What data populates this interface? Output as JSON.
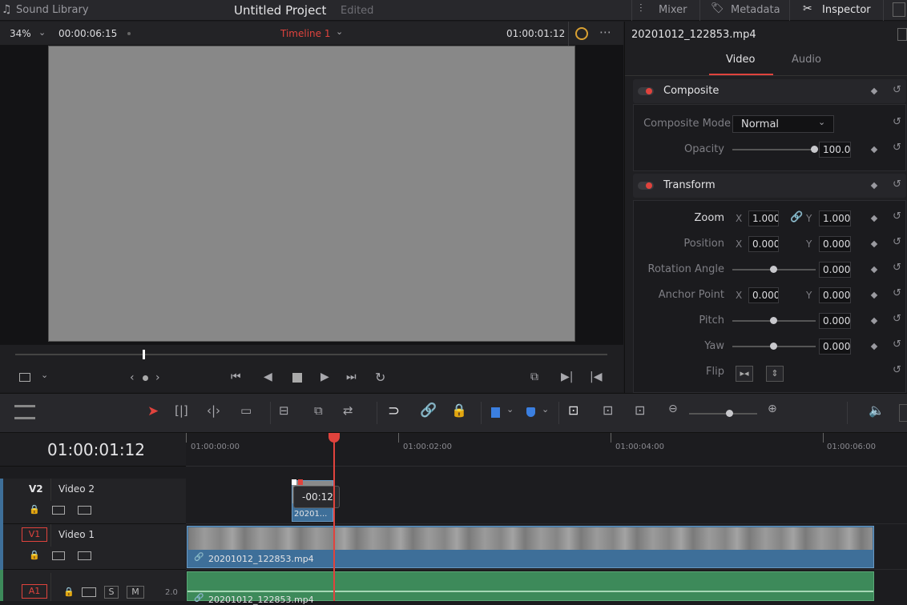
{
  "topbar": {
    "sound_library": "Sound Library",
    "project_title": "Untitled Project",
    "project_status": "Edited",
    "mixer": "Mixer",
    "metadata": "Metadata",
    "inspector": "Inspector"
  },
  "viewer": {
    "zoom": "34%",
    "duration": "00:00:06:15",
    "timeline_name": "Timeline 1",
    "timecode": "01:00:01:12"
  },
  "inspector": {
    "clip_name": "20201012_122853.mp4",
    "tabs": [
      "Video",
      "Audio"
    ],
    "composite": {
      "title": "Composite",
      "mode_label": "Composite Mode",
      "mode_value": "Normal",
      "opacity_label": "Opacity",
      "opacity_value": "100.0",
      "opacity_fraction": 1.0
    },
    "transform": {
      "title": "Transform",
      "zoom_label": "Zoom",
      "zoom_x": "1.000",
      "zoom_y": "1.000",
      "position_label": "Position",
      "position_x": "0.000",
      "position_y": "0.000",
      "rotation_label": "Rotation Angle",
      "rotation_value": "0.000",
      "anchor_label": "Anchor Point",
      "anchor_x": "0.000",
      "anchor_y": "0.000",
      "pitch_label": "Pitch",
      "pitch_value": "0.000",
      "yaw_label": "Yaw",
      "yaw_value": "0.000",
      "flip_label": "Flip",
      "x_axis": "X",
      "y_axis": "Y"
    }
  },
  "timeline": {
    "timecode": "01:00:01:12",
    "ruler": [
      "01:00:00:00",
      "01:00:02:00",
      "01:00:04:00",
      "01:00:06:00"
    ],
    "tracks": [
      {
        "id": "V2",
        "name": "Video 2"
      },
      {
        "id": "V1",
        "name": "Video 1"
      },
      {
        "id": "A1",
        "name": "",
        "channels": "2.0",
        "s": "S",
        "m": "M"
      }
    ],
    "clip_v2_label": "20201...",
    "tooltip": "-00:12",
    "clip_v1_label": "20201012_122853.mp4",
    "clip_a1_label": "20201012_122853.mp4"
  },
  "colors": {
    "accent_red": "#e0433d",
    "clip_blue": "#3e6f99",
    "audio_green": "#3d8a5a"
  }
}
